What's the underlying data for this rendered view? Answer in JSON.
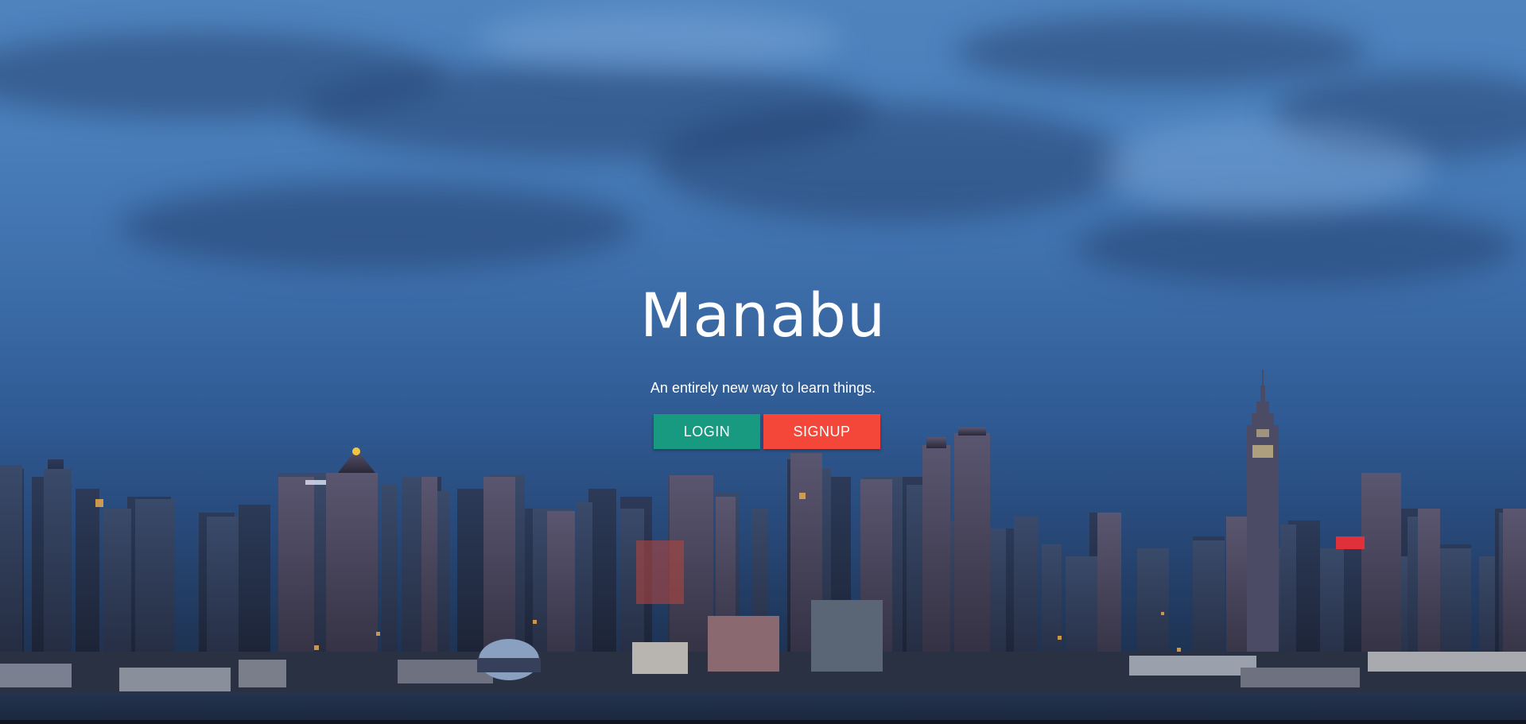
{
  "hero": {
    "title": "Manabu",
    "tagline": "An entirely new way to learn things."
  },
  "actions": {
    "login_label": "LOGIN",
    "signup_label": "SIGNUP"
  },
  "colors": {
    "login_button": "#179a7f",
    "signup_button": "#f4473a",
    "sky_top": "#4f83bd",
    "sky_bottom": "#1b2c45"
  }
}
